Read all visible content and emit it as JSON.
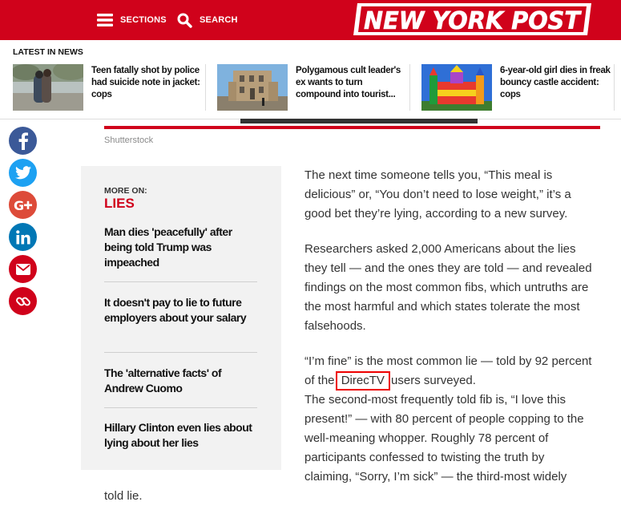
{
  "header": {
    "sections_label": "SECTIONS",
    "search_label": "SEARCH",
    "logo_text": "NEW YORK POST",
    "brand_color": "#d0021b"
  },
  "latest": {
    "heading": "LATEST IN NEWS",
    "items": [
      {
        "title": "Teen fatally shot by police had suicide note in jacket: cops"
      },
      {
        "title": "Polygamous cult leader's ex wants to turn compound into tourist..."
      },
      {
        "title": "6-year-old girl dies in freak bouncy castle accident: cops"
      }
    ]
  },
  "image_credit": "Shutterstock",
  "share": {
    "icons": [
      "facebook-icon",
      "twitter-icon",
      "google-plus-icon",
      "linkedin-icon",
      "email-icon",
      "link-icon"
    ],
    "colors": {
      "facebook": "#3b5998",
      "twitter": "#1da1f2",
      "google_plus": "#dd4b39",
      "linkedin": "#0077b5",
      "email": "#d0021b",
      "link": "#d0021b"
    }
  },
  "more_on": {
    "label": "MORE ON:",
    "topic": "LIES",
    "links": [
      "Man dies 'peacefully' after being told Trump was impeached",
      "It doesn't pay to lie to future employers about your salary",
      "The 'alternative facts' of Andrew Cuomo",
      "Hillary Clinton even lies about lying about her lies"
    ]
  },
  "article": {
    "p1": "The next time someone tells you, “This meal is delicious” or, “You don’t need to lose weight,” it’s a good bet they’re lying, according to a new survey.",
    "p2": "Researchers asked 2,000 Americans about the lies they tell — and the ones they are told — and revealed findings on the most common fibs, which untruths are the most harmful and which states tolerate the most falsehoods.",
    "p3_before": "“I’m fine” is the most common lie — told by 92 percent of the ",
    "p3_highlight": "DirecTV",
    "p3_after": " users surveyed.",
    "p4": "The second-most frequently told fib is, “I love this present!” — with 80 percent of people copping to the well-meaning whopper. Roughly 78 percent of participants confessed to twisting the truth by claiming, “Sorry, I’m sick” — the third-most widely",
    "tail": "told lie."
  }
}
